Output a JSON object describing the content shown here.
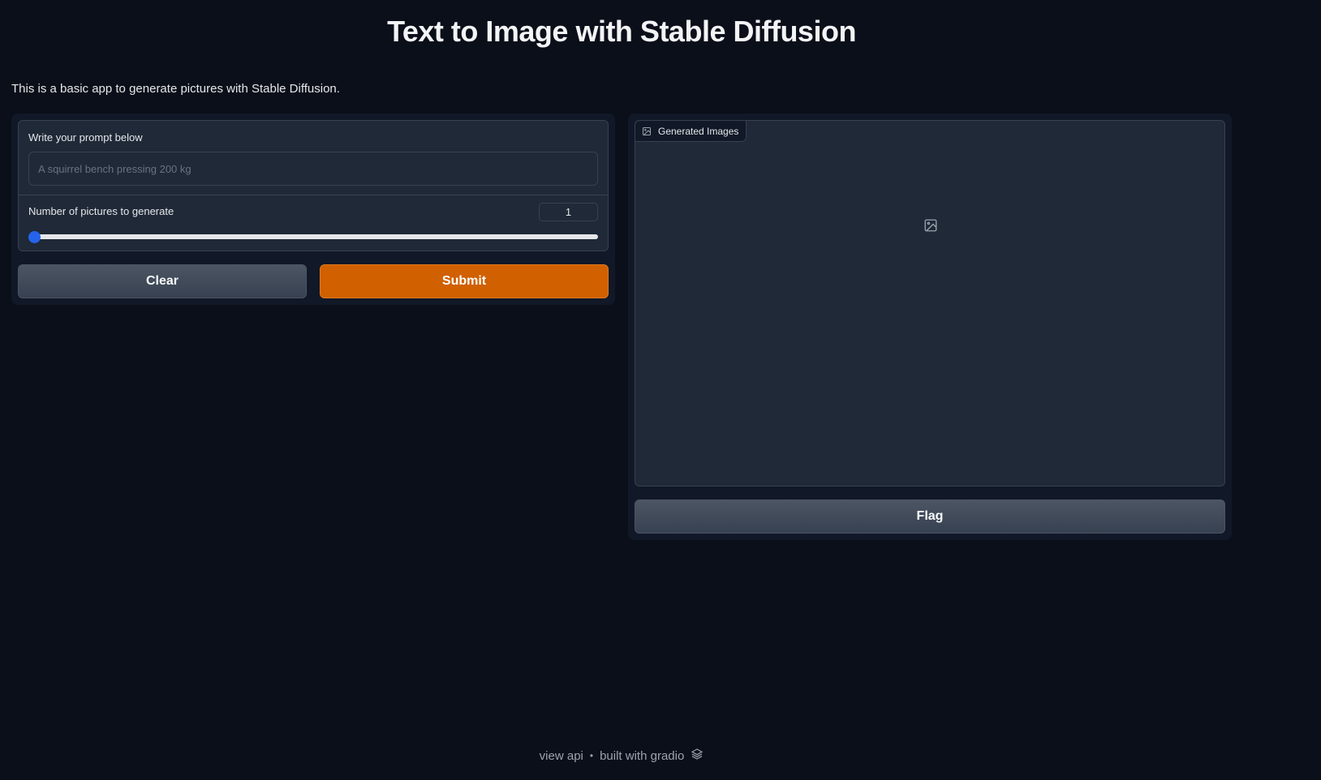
{
  "header": {
    "title": "Text to Image with Stable Diffusion",
    "description": "This is a basic app to generate pictures with Stable Diffusion."
  },
  "form": {
    "prompt_label": "Write your prompt below",
    "prompt_placeholder": "A squirrel bench pressing 200 kg",
    "prompt_value": "",
    "num_label": "Number of pictures to generate",
    "num_value": "1",
    "slider_fraction": 0
  },
  "buttons": {
    "clear_label": "Clear",
    "submit_label": "Submit",
    "flag_label": "Flag"
  },
  "output": {
    "gallery_label": "Generated Images",
    "gallery_icon": "image-icon"
  },
  "footer": {
    "view_api": "view api",
    "separator": "•",
    "built_with": "built with gradio",
    "logo_icon": "gradio-logo-icon"
  },
  "colors": {
    "background": "#0b0f19",
    "panel": "#111827",
    "block": "#1f2937",
    "submit": "#d06000",
    "slider_thumb": "#2563eb"
  }
}
